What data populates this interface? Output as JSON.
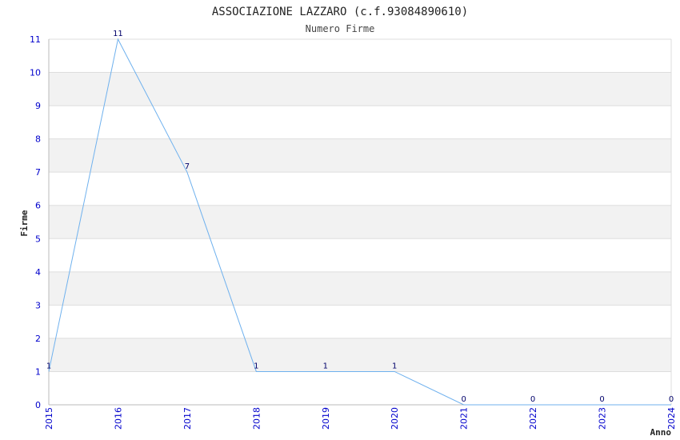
{
  "chart_data": {
    "type": "line",
    "title": "ASSOCIAZIONE LAZZARO (c.f.93084890610)",
    "subtitle": "Numero Firme",
    "xlabel": "Anno",
    "ylabel": "Firme",
    "x": [
      "2015",
      "2016",
      "2017",
      "2018",
      "2019",
      "2020",
      "2021",
      "2022",
      "2023",
      "2024"
    ],
    "y_ticks": [
      "0",
      "1",
      "2",
      "3",
      "4",
      "5",
      "6",
      "7",
      "8",
      "9",
      "10",
      "11"
    ],
    "series": [
      {
        "points": [
          {
            "x": 2015,
            "y": 1
          },
          {
            "x": 2016,
            "y": 11
          },
          {
            "x": 2017,
            "y": 7
          },
          {
            "x": 2018,
            "y": 1
          },
          {
            "x": 2019,
            "y": 1
          },
          {
            "x": 2020,
            "y": 1
          },
          {
            "x": 2021,
            "y": 0
          },
          {
            "x": 2022,
            "y": 0
          },
          {
            "x": 2023,
            "y": 0
          },
          {
            "x": 2024,
            "y": 0
          }
        ],
        "labels": [
          "1",
          "11",
          "7",
          "1",
          "1",
          "1",
          "0",
          "0",
          "0",
          "0"
        ]
      }
    ],
    "xlim": [
      2015,
      2024
    ],
    "ylim": [
      0,
      11
    ],
    "grid": "horizontal bands",
    "colors": {
      "line": "#6fb1ee",
      "tick_labels": "#0000cc",
      "data_labels": "#00006a",
      "band": "#f2f2f2",
      "title": "#222222"
    }
  }
}
